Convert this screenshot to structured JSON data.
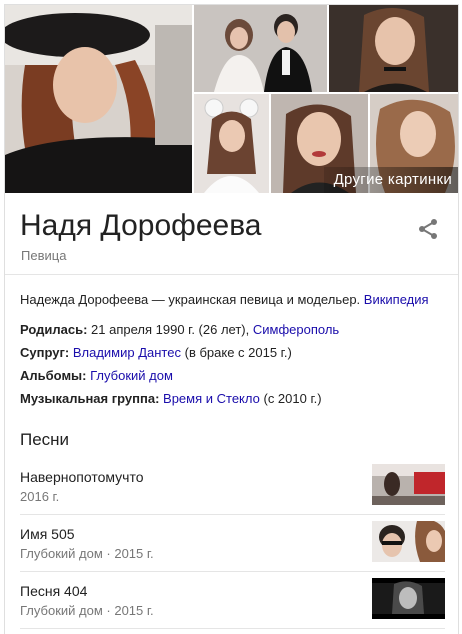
{
  "images": {
    "more_label": "Другие картинки",
    "items": [
      {
        "name": "photo-main",
        "desc": "portrait-leather-jacket-hat"
      },
      {
        "name": "photo-wedding",
        "desc": "couple-wedding"
      },
      {
        "name": "photo-choker",
        "desc": "portrait-choker"
      },
      {
        "name": "photo-mouse-ears",
        "desc": "portrait-mouse-ears"
      },
      {
        "name": "photo-sweater",
        "desc": "portrait-lips"
      },
      {
        "name": "photo-curls",
        "desc": "portrait-curls"
      }
    ]
  },
  "header": {
    "title": "Надя Дорофеева",
    "subtitle": "Певица",
    "share_icon": "share-icon"
  },
  "description": {
    "text": "Надежда Дорофеева — украинская певица и модельер.",
    "source_link": "Википедия"
  },
  "facts": {
    "born_label": "Родилась:",
    "born_value": "21 апреля 1990 г. (26 лет),",
    "born_place": "Симферополь",
    "spouse_label": "Супруг:",
    "spouse_value": "Владимир Дантес",
    "spouse_note": "(в браке с 2015 г.)",
    "albums_label": "Альбомы:",
    "albums_value": "Глубокий дом",
    "group_label": "Музыкальная группа:",
    "group_value": "Время и Стекло",
    "group_note": "(с 2010 г.)"
  },
  "songs": {
    "title": "Песни",
    "items": [
      {
        "name": "Навернопотомучто",
        "meta": "2016 г."
      },
      {
        "name": "Имя 505",
        "meta": "Глубокий дом · 2015 г."
      },
      {
        "name": "Песня 404",
        "meta": "Глубокий дом · 2015 г."
      }
    ]
  },
  "colors": {
    "link": "#1a0dab",
    "secondary_text": "#777777",
    "divider": "#e5e5e5"
  }
}
